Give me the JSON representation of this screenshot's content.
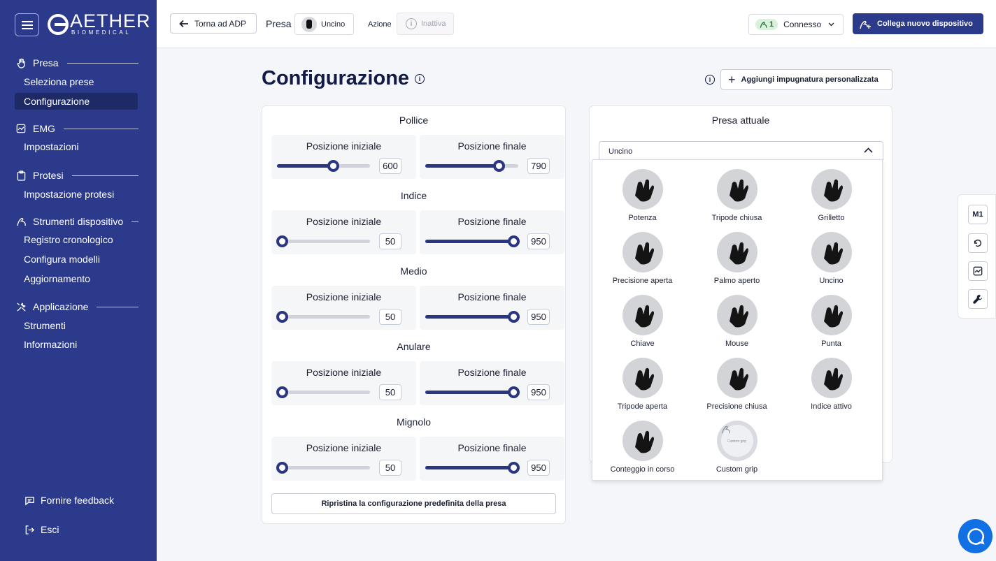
{
  "brand": {
    "title": "AETHER",
    "subtitle": "BIOMEDICAL"
  },
  "sidebar": {
    "sections": [
      {
        "label": "Presa",
        "icon": "hand-icon",
        "items": [
          "Seleziona prese",
          "Configurazione"
        ]
      },
      {
        "label": "EMG",
        "icon": "chart-icon",
        "items": [
          "Impostazioni"
        ]
      },
      {
        "label": "Protesi",
        "icon": "clipboard-icon",
        "items": [
          "Impostazione protesi"
        ]
      },
      {
        "label": "Strumenti dispositivo",
        "icon": "arm-icon",
        "items": [
          "Registro cronologico",
          "Configura modelli",
          "Aggiornamento"
        ]
      },
      {
        "label": "Applicazione",
        "icon": "tools-icon",
        "items": [
          "Strumenti",
          "Informazioni"
        ]
      }
    ],
    "active_item": "Configurazione",
    "feedback": "Fornire feedback",
    "logout": "Esci"
  },
  "topbar": {
    "back": "Torna ad ADP",
    "grip_label": "Presa",
    "grip_value": "Uncino",
    "action_label": "Azione",
    "action_value": "Inattiva",
    "connection_count": "1",
    "connection_status": "Connesso",
    "connect_new": "Collega nuovo dispositivo"
  },
  "main": {
    "title": "Configurazione",
    "add_custom_grip": "Aggiungi impugnatura personalizzata",
    "initial_label": "Posizione iniziale",
    "final_label": "Posizione finale",
    "fingers": [
      {
        "name": "Pollice",
        "initial": 600,
        "final": 790
      },
      {
        "name": "Indice",
        "initial": 50,
        "final": 950
      },
      {
        "name": "Medio",
        "initial": 50,
        "final": 950
      },
      {
        "name": "Anulare",
        "initial": 50,
        "final": 950
      },
      {
        "name": "Mignolo",
        "initial": 50,
        "final": 950
      }
    ],
    "slider_max": 1000,
    "reset": "Ripristina la configurazione predefinita della presa"
  },
  "current_grip": {
    "title": "Presa attuale",
    "selected": "Uncino",
    "options": [
      "Potenza",
      "Tripode chiusa",
      "Grilletto",
      "Precisione aperta",
      "Palmo aperto",
      "Uncino",
      "Chiave",
      "Mouse",
      "Punta",
      "Tripode aperta",
      "Precisione chiusa",
      "Indice attivo",
      "Conteggio in corso",
      "Custom grip"
    ],
    "custom_mini": "Custom grip"
  },
  "tools": {
    "m1": "M1"
  },
  "colors": {
    "primary": "#2c3a8c",
    "chat": "#1170e4"
  }
}
